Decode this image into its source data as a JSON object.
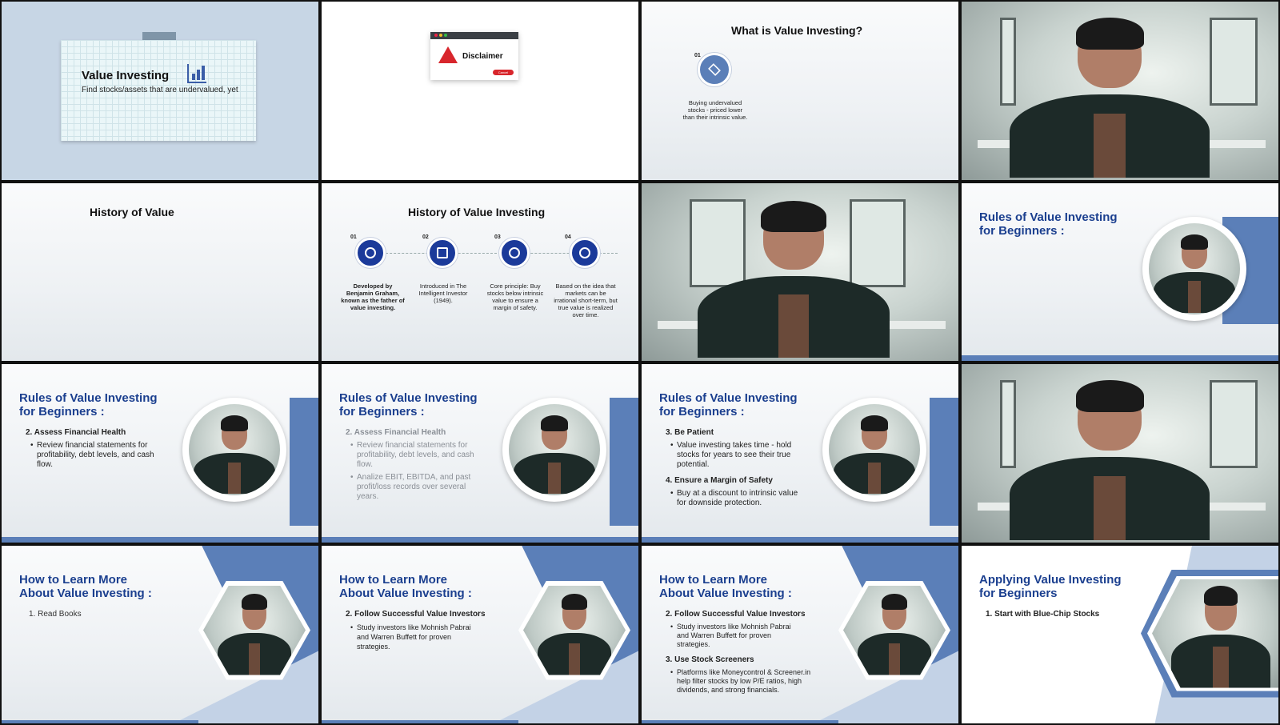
{
  "slides": {
    "s1": {
      "title": "Value Investing",
      "subtitle": "Find stocks/assets that are undervalued, yet"
    },
    "s2": {
      "dialog_title": "Disclaimer",
      "cancel_label": "Cancel"
    },
    "s3": {
      "title": "What is Value Investing?",
      "num": "01",
      "caption": "Buying undervalued stocks - priced lower than their intrinsic value."
    },
    "s5": {
      "title": "History of Value"
    },
    "s6": {
      "title": "History of Value Investing",
      "steps": [
        {
          "num": "01",
          "caption": "Developed by Benjamin Graham, known as the father of value investing."
        },
        {
          "num": "02",
          "caption": "Introduced in The Intelligent Investor (1949)."
        },
        {
          "num": "03",
          "caption": "Core principle: Buy stocks below intrinsic value to ensure a margin of safety."
        },
        {
          "num": "04",
          "caption": "Based on the idea that markets can be irrational short-term, but true value is realized over time."
        }
      ]
    },
    "rules_title_line1": "Rules of Value Investing",
    "rules_title_line2": "for Beginners :",
    "s9": {
      "h1": "2. Assess Financial Health",
      "b1": "Review financial statements for profitability, debt levels, and cash flow."
    },
    "s10": {
      "h1": "2. Assess Financial Health",
      "b1": "Review financial statements for profitability, debt levels, and cash flow.",
      "b2": "Analize EBIT, EBITDA, and past profit/loss records over several years."
    },
    "s11": {
      "h1": "3. Be Patient",
      "b1": "Value investing takes time - hold stocks for years to see their true potential.",
      "h2": "4. Ensure a Margin of Safety",
      "b2": "Buy at a discount to intrinsic value for downside protection."
    },
    "learn_title_line1": "How to Learn More",
    "learn_title_line2": "About Value Investing :",
    "s13": {
      "h1": "1. Read Books"
    },
    "s14": {
      "h1": "2. Follow Successful Value Investors",
      "b1": "Study investors like Mohnish Pabrai and Warren Buffett for proven strategies."
    },
    "s15": {
      "h1": "2. Follow Successful Value Investors",
      "b1": "Study investors like Mohnish Pabrai and Warren Buffett for proven strategies.",
      "h2": "3. Use Stock Screeners",
      "b2": "Platforms like Moneycontrol & Screener.in help filter stocks by low P/E ratios, high dividends, and strong financials."
    },
    "s16": {
      "title_line1": "Applying Value Investing",
      "title_line2": "for Beginners",
      "h1": "1. Start with Blue-Chip Stocks"
    }
  }
}
